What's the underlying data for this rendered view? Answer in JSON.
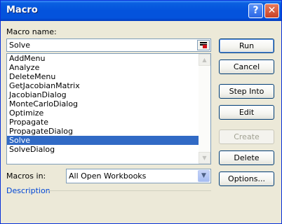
{
  "title": "Macro",
  "title_buttons": {
    "help": "?",
    "close": "✕"
  },
  "macro_name_label": "Macro name:",
  "macro_name_value": "Solve",
  "macros": [
    "AddMenu",
    "Analyze",
    "DeleteMenu",
    "GetJacobianMatrix",
    "JacobianDialog",
    "MonteCarloDialog",
    "Optimize",
    "Propagate",
    "PropagateDialog",
    "Solve",
    "SolveDialog"
  ],
  "selected_macro": "Solve",
  "macros_in_label": "Macros in:",
  "macros_in_value": "All Open Workbooks",
  "description_label": "Description",
  "buttons": {
    "run": "Run",
    "cancel": "Cancel",
    "step_into": "Step Into",
    "edit": "Edit",
    "create": "Create",
    "delete": "Delete",
    "options": "Options..."
  },
  "colors": {
    "selection": "#316ac5",
    "title_bar": "#0453dc",
    "description_text": "#0046d5"
  }
}
